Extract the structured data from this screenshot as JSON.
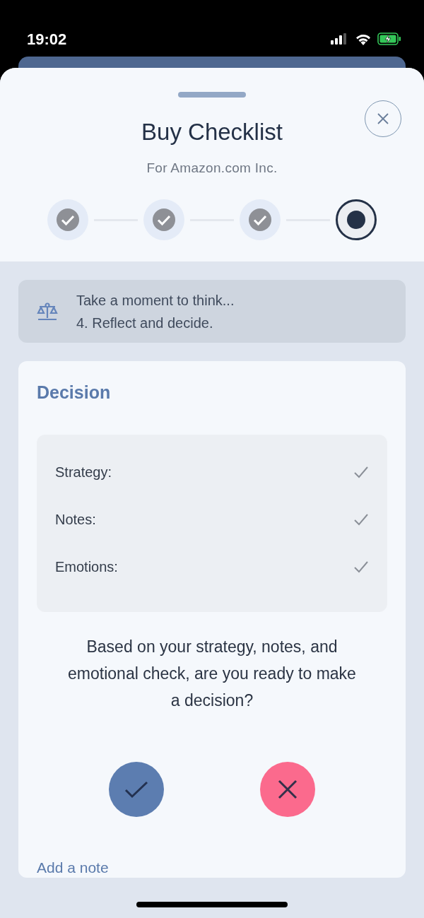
{
  "status_bar": {
    "time": "19:02"
  },
  "sheet": {
    "title": "Buy Checklist",
    "subtitle": "For Amazon.com Inc."
  },
  "steps": [
    {
      "completed": true
    },
    {
      "completed": true
    },
    {
      "completed": true
    },
    {
      "completed": false
    }
  ],
  "banner": {
    "lines": [
      "Take a moment to think...",
      "4. Reflect and decide."
    ]
  },
  "decision": {
    "title": "Decision",
    "items": [
      {
        "label": "Strategy:",
        "checked": true
      },
      {
        "label": "Notes:",
        "checked": true
      },
      {
        "label": "Emotions:",
        "checked": true
      }
    ],
    "question": "Based on your strategy, notes, and emotional check, are you ready to make a decision?",
    "note_link": "Add a note"
  }
}
